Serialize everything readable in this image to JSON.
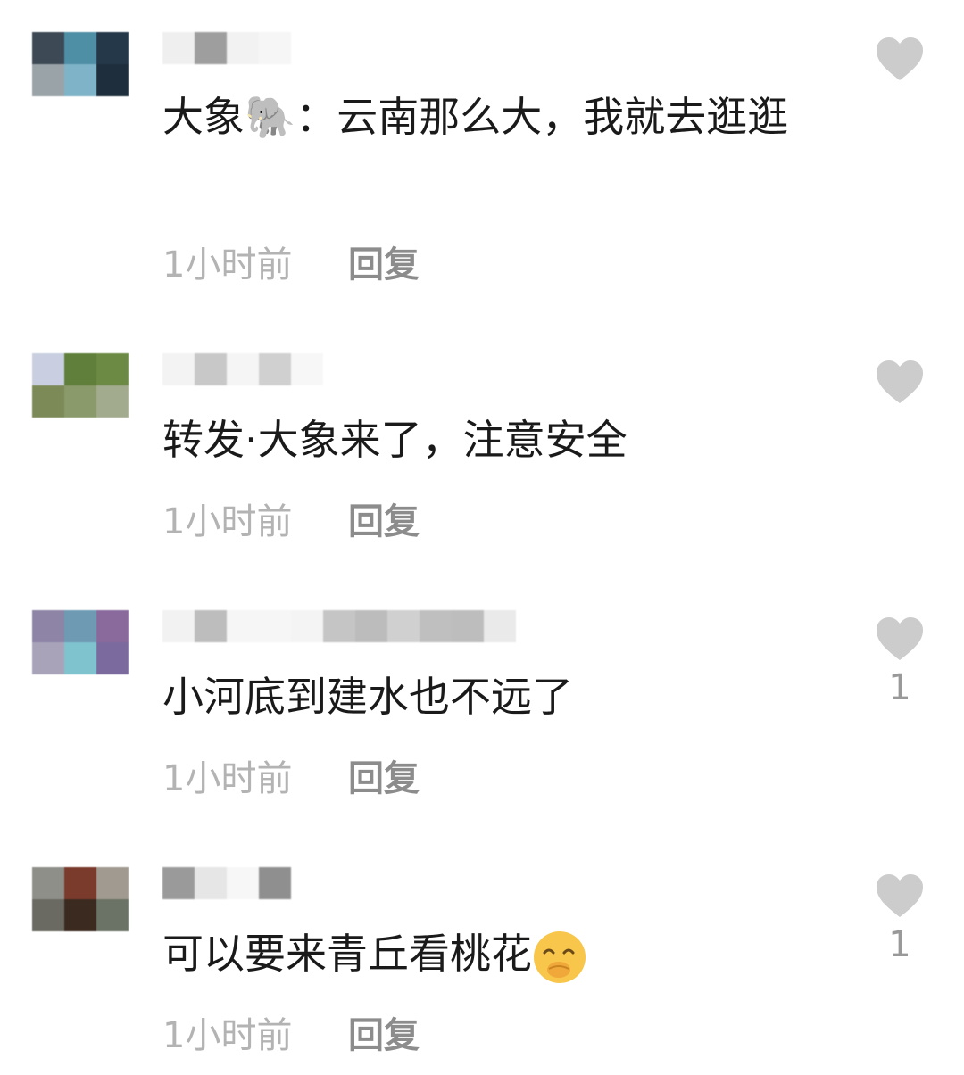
{
  "colors": {
    "text": "#1a1a1a",
    "timestamp": "#b3b3b3",
    "reply": "#8c8c8c",
    "heart": "#cccccc",
    "count": "#999999"
  },
  "comments": [
    {
      "text": "大象🐘：云南那么大，我就去逛逛",
      "time": "1小时前",
      "reply_label": "回复",
      "likes": "",
      "avatar_icon": "blurred-avatar-icon"
    },
    {
      "text": "转发·大象来了，注意安全",
      "time": "1小时前",
      "reply_label": "回复",
      "likes": "",
      "avatar_icon": "blurred-avatar-icon"
    },
    {
      "text": "小河底到建水也不远了",
      "time": "1小时前",
      "reply_label": "回复",
      "likes": "1",
      "avatar_icon": "blurred-avatar-icon"
    },
    {
      "text": "可以要来青丘看桃花",
      "time": "1小时前",
      "reply_label": "回复",
      "likes": "1",
      "avatar_icon": "blurred-avatar-icon",
      "trailing_emoji": "smiling-face-with-hand-over-mouth-icon"
    }
  ]
}
